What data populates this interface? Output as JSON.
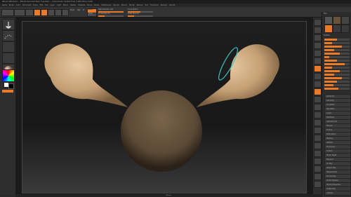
{
  "window": {
    "title": "ZBrush 4R6 64-bit  — ZBrush Document  Mem:  Free Mem  — Active Points: 52,690  Timer: 0.005  ATime: 0.000"
  },
  "menu": {
    "items": [
      "Alpha",
      "Brush",
      "Color",
      "Document",
      "Draw",
      "Edit",
      "File",
      "Layer",
      "Light",
      "Macro",
      "Marker",
      "Material",
      "Movie",
      "Picker",
      "Preferences",
      "Render",
      "Stencil",
      "Stroke",
      "Texture",
      "Tool",
      "Transform",
      "Zplugin",
      "Zscript"
    ]
  },
  "toolbar": {
    "projection_label": "Projection Master",
    "lightbox_label": "LightBox",
    "quicksketch_label": "Quick Sketch",
    "edit_label": "Edit",
    "draw_label": "Draw",
    "move_label": "Move",
    "scale_label": "Scale",
    "rotate_label": "Rotate",
    "mrgb_label": "Mrgb",
    "rgb_label": "Rgb",
    "m_label": "M",
    "zadd_label": "Zadd",
    "zsub_label": "Zsub",
    "focal_label": "Focal Shift 0",
    "draw_size_label": "Draw Size 64",
    "rgb_intensity_label": "Rgb Intensity 100",
    "z_intensity_label": "Z Intensity 25",
    "rgb_intensity": 1.0,
    "z_intensity": 0.25,
    "draw_size": 0.25
  },
  "palette": {
    "header": "Tool",
    "sub_header": "SubTool",
    "items": [
      "Subdivide",
      "Geometry",
      "ArrayMesh",
      "NanoMesh",
      "Layers",
      "FiberMesh",
      "Geometry HD",
      "Preview",
      "Surface",
      "Deformation",
      "Masking",
      "Visibility",
      "Polygroups",
      "Contact",
      "Morph Target",
      "Polypaint",
      "UV Map",
      "Texture Map",
      "Displacement",
      "Normal Map",
      "Vector Displace",
      "Display Properties",
      "Unified Skin",
      "Initialize",
      "Import",
      "Export"
    ],
    "slider_levels": [
      0.5,
      0.3,
      0.7,
      0.4,
      0.6,
      0.2,
      0.5,
      0.8,
      0.3,
      0.6,
      0.4,
      0.7,
      0.5,
      0.35,
      0.55
    ]
  },
  "status": {
    "bottom": "ZBrush"
  },
  "colors": {
    "accent": "#e87a2a",
    "clay": "#c9a880",
    "clay_dark": "#6a5238",
    "selection_ring": "#3fc3c0"
  }
}
